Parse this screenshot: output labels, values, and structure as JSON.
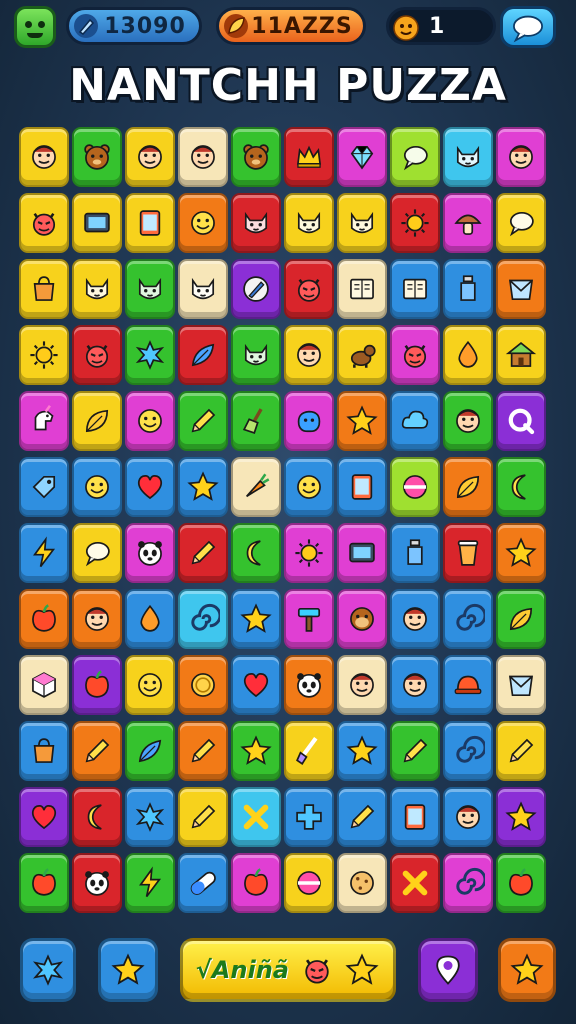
{
  "hud": {
    "score": "13090",
    "coins": "11AZZS",
    "lives": "1",
    "mascot_icon": "green-monster-icon",
    "score_icon": "pencil-icon",
    "coins_icon": "leaf-icon",
    "lives_icon": "orange-blob-icon",
    "chat_icon": "speech-bubble-icon"
  },
  "title": "NANTCHH PUZZA",
  "colors": {
    "yellow": "#f7d21c",
    "green": "#35c22e",
    "red": "#d9252b",
    "blue": "#2f8fe0",
    "cyan": "#3fc6ee",
    "magenta": "#e03fd3",
    "purple": "#8b2fd6",
    "orange": "#f27a17",
    "cream": "#f7e6b8",
    "lime": "#9fe030"
  },
  "board": [
    [
      [
        "yellow",
        "face"
      ],
      [
        "green",
        "bear"
      ],
      [
        "yellow",
        "face"
      ],
      [
        "cream",
        "face"
      ],
      [
        "green",
        "bear"
      ],
      [
        "red",
        "crown"
      ],
      [
        "magenta",
        "gem"
      ],
      [
        "lime",
        "bubble"
      ],
      [
        "cyan",
        "cat"
      ],
      [
        "magenta",
        "face"
      ]
    ],
    [
      [
        "yellow",
        "devil"
      ],
      [
        "yellow",
        "tv"
      ],
      [
        "yellow",
        "tablet"
      ],
      [
        "orange",
        "smile"
      ],
      [
        "red",
        "cat"
      ],
      [
        "yellow",
        "cat"
      ],
      [
        "yellow",
        "cat"
      ],
      [
        "red",
        "sun"
      ],
      [
        "magenta",
        "mushroom"
      ],
      [
        "yellow",
        "bubble"
      ]
    ],
    [
      [
        "yellow",
        "bag"
      ],
      [
        "yellow",
        "cat"
      ],
      [
        "green",
        "cat"
      ],
      [
        "cream",
        "cat"
      ],
      [
        "purple",
        "pen"
      ],
      [
        "red",
        "devil"
      ],
      [
        "cream",
        "book"
      ],
      [
        "blue",
        "book"
      ],
      [
        "blue",
        "bottle"
      ],
      [
        "orange",
        "paper"
      ]
    ],
    [
      [
        "yellow",
        "sun"
      ],
      [
        "red",
        "devil"
      ],
      [
        "green",
        "splat"
      ],
      [
        "red",
        "feather"
      ],
      [
        "green",
        "cat"
      ],
      [
        "yellow",
        "face"
      ],
      [
        "yellow",
        "dog"
      ],
      [
        "magenta",
        "devil"
      ],
      [
        "yellow",
        "drop"
      ],
      [
        "yellow",
        "hut"
      ]
    ],
    [
      [
        "magenta",
        "unicorn"
      ],
      [
        "yellow",
        "leaf"
      ],
      [
        "magenta",
        "smile"
      ],
      [
        "green",
        "pencil"
      ],
      [
        "green",
        "broom"
      ],
      [
        "magenta",
        "blob"
      ],
      [
        "orange",
        "star"
      ],
      [
        "blue",
        "cloud"
      ],
      [
        "green",
        "face"
      ],
      [
        "purple",
        "q"
      ]
    ],
    [
      [
        "blue",
        "tag"
      ],
      [
        "blue",
        "smile"
      ],
      [
        "blue",
        "heart"
      ],
      [
        "blue",
        "star"
      ],
      [
        "cream",
        "carrot"
      ],
      [
        "blue",
        "smile"
      ],
      [
        "blue",
        "tablet"
      ],
      [
        "lime",
        "ball"
      ],
      [
        "orange",
        "leaf"
      ],
      [
        "green",
        "moon"
      ]
    ],
    [
      [
        "blue",
        "bolt"
      ],
      [
        "yellow",
        "bubble"
      ],
      [
        "magenta",
        "panda"
      ],
      [
        "red",
        "pencil"
      ],
      [
        "green",
        "moon"
      ],
      [
        "magenta",
        "sun"
      ],
      [
        "magenta",
        "tv"
      ],
      [
        "blue",
        "bottle"
      ],
      [
        "red",
        "cup"
      ],
      [
        "orange",
        "star"
      ]
    ],
    [
      [
        "orange",
        "apple"
      ],
      [
        "orange",
        "face"
      ],
      [
        "blue",
        "drop"
      ],
      [
        "cyan",
        "swirl"
      ],
      [
        "blue",
        "star"
      ],
      [
        "magenta",
        "hammer"
      ],
      [
        "magenta",
        "monkey"
      ],
      [
        "blue",
        "face"
      ],
      [
        "blue",
        "swirl"
      ],
      [
        "green",
        "leaf"
      ]
    ],
    [
      [
        "cream",
        "cube"
      ],
      [
        "purple",
        "apple"
      ],
      [
        "yellow",
        "smile"
      ],
      [
        "orange",
        "coin"
      ],
      [
        "blue",
        "heart"
      ],
      [
        "orange",
        "panda"
      ],
      [
        "cream",
        "face"
      ],
      [
        "blue",
        "face"
      ],
      [
        "blue",
        "hat"
      ],
      [
        "cream",
        "paper"
      ]
    ],
    [
      [
        "blue",
        "bag"
      ],
      [
        "orange",
        "pencil"
      ],
      [
        "green",
        "feather"
      ],
      [
        "orange",
        "pencil"
      ],
      [
        "green",
        "star"
      ],
      [
        "yellow",
        "brush"
      ],
      [
        "blue",
        "star"
      ],
      [
        "green",
        "pencil"
      ],
      [
        "blue",
        "swirl"
      ],
      [
        "yellow",
        "pencil"
      ]
    ],
    [
      [
        "purple",
        "heart"
      ],
      [
        "red",
        "moon"
      ],
      [
        "blue",
        "splat"
      ],
      [
        "yellow",
        "pencil"
      ],
      [
        "cyan",
        "x"
      ],
      [
        "blue",
        "cross"
      ],
      [
        "blue",
        "pencil"
      ],
      [
        "blue",
        "tablet"
      ],
      [
        "blue",
        "face"
      ],
      [
        "purple",
        "star"
      ]
    ],
    [
      [
        "green",
        "apple"
      ],
      [
        "red",
        "panda"
      ],
      [
        "green",
        "bolt"
      ],
      [
        "blue",
        "pill"
      ],
      [
        "magenta",
        "apple"
      ],
      [
        "yellow",
        "ball"
      ],
      [
        "cream",
        "cookie"
      ],
      [
        "red",
        "x"
      ],
      [
        "magenta",
        "swirl"
      ],
      [
        "green",
        "apple"
      ]
    ]
  ],
  "bottom": {
    "left1": [
      "blue",
      "splat"
    ],
    "left2": [
      "blue",
      "star"
    ],
    "center_label": "√Aniñã",
    "center_icons": [
      "devil",
      "star"
    ],
    "right1": [
      "purple",
      "pin"
    ],
    "right2": [
      "orange",
      "star"
    ]
  }
}
